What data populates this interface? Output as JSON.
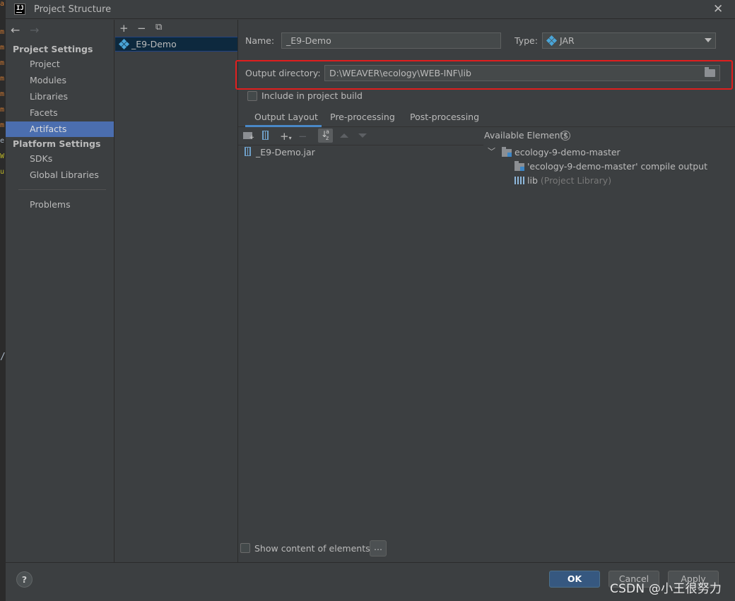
{
  "window": {
    "title": "Project Structure"
  },
  "sidebar": {
    "project_settings_header": "Project Settings",
    "platform_settings_header": "Platform Settings",
    "items": [
      {
        "label": "Project"
      },
      {
        "label": "Modules"
      },
      {
        "label": "Libraries"
      },
      {
        "label": "Facets"
      },
      {
        "label": "Artifacts",
        "selected": true
      },
      {
        "label": "SDKs"
      },
      {
        "label": "Global Libraries"
      },
      {
        "label": "Problems"
      }
    ]
  },
  "artifacts": {
    "items": [
      {
        "name": "_E9-Demo"
      }
    ]
  },
  "form": {
    "name_label": "Name:",
    "name_value": "_E9-Demo",
    "type_label": "Type:",
    "type_value": "JAR",
    "output_dir_label": "Output directory:",
    "output_dir_value": "D:\\WEAVER\\ecology\\WEB-INF\\lib",
    "include_build_label": "Include in project build",
    "include_build_checked": false
  },
  "tabs": [
    {
      "label": "Output Layout",
      "active": true
    },
    {
      "label": "Pre-processing"
    },
    {
      "label": "Post-processing"
    }
  ],
  "output_layout": {
    "root_item": "_E9-Demo.jar",
    "available_elements_label": "Available Elements",
    "tree": {
      "module": "ecology-9-demo-master",
      "compile_output": "'ecology-9-demo-master' compile output",
      "lib_name": "lib",
      "lib_note": "(Project Library)"
    }
  },
  "show_content_label": "Show content of elements",
  "ellipsis_label": "...",
  "buttons": {
    "help": "?",
    "ok": "OK",
    "cancel": "Cancel",
    "apply": "Apply"
  },
  "watermark": "CSDN @小王很努力",
  "edge_glyphs": [
    "a",
    "m",
    "m",
    "m",
    "m",
    "m",
    "m",
    "m",
    "e",
    "W",
    "u",
    "/"
  ],
  "colors": {
    "selection": "#4b6eaf",
    "accent": "#4a88c7",
    "highlight_box": "#e01e1e",
    "ok_button": "#365880"
  }
}
